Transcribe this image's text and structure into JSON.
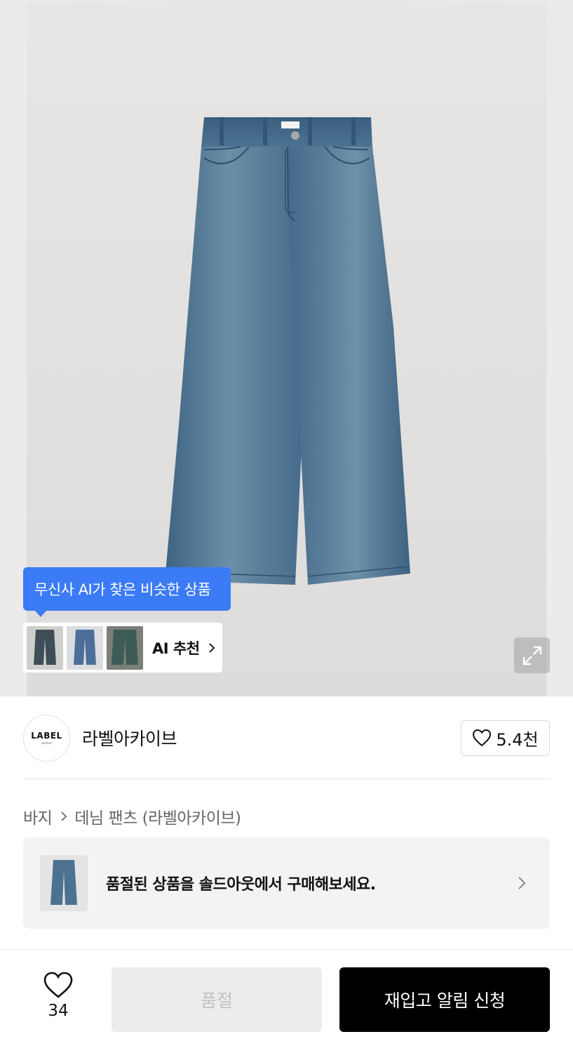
{
  "ai_recommend": {
    "tooltip": "무신사 AI가 찾은 비슷한 상품",
    "label": "AI 추천"
  },
  "brand": {
    "logo_text": "LABEL",
    "logo_subtext": "archive",
    "name": "라벨아카이브",
    "like_count": "5.4천"
  },
  "breadcrumb": {
    "category": "바지",
    "subcategory": "데님 팬츠 (라벨아카이브)"
  },
  "soldout_banner": {
    "text": "품절된 상품을 솔드아웃에서 구매해보세요."
  },
  "bottom_bar": {
    "wish_count": "34",
    "soldout_label": "품절",
    "restock_label": "재입고 알림 신청"
  },
  "colors": {
    "accent_blue": "#3b7bf6",
    "denim": "#4a6f8c",
    "primary_button": "#000000"
  }
}
